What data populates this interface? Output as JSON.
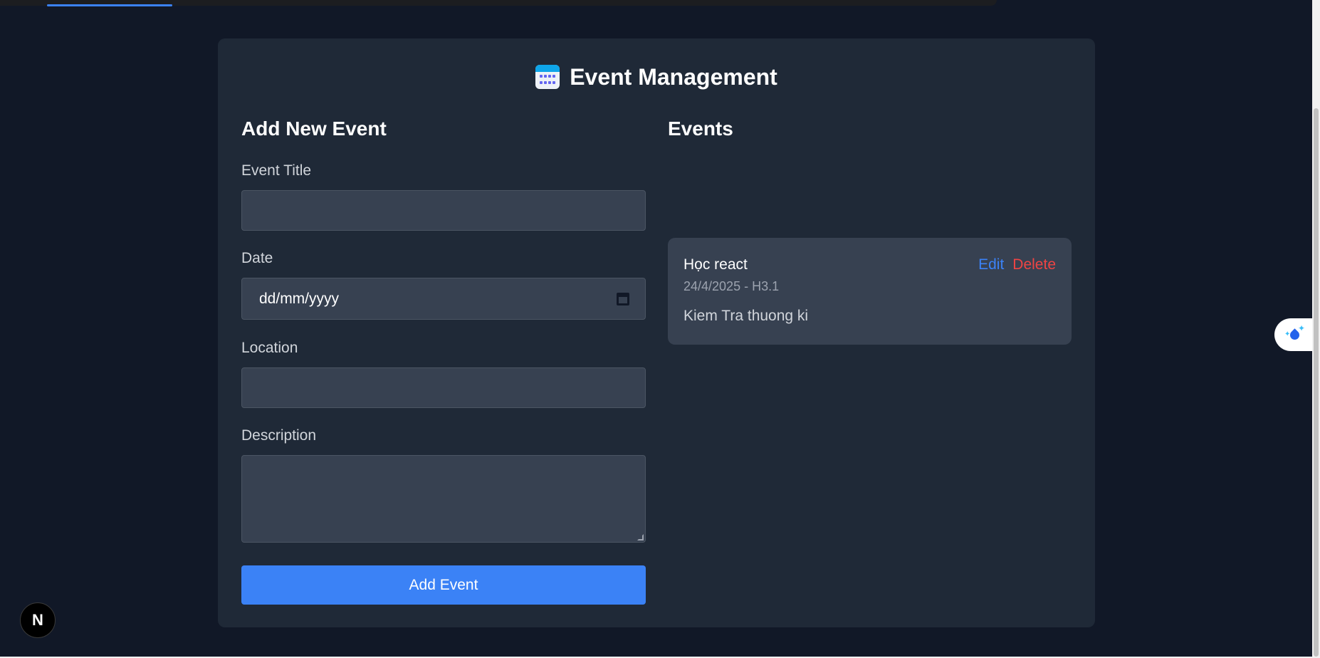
{
  "app": {
    "title": "Event Management",
    "title_icon": "calendar-icon"
  },
  "form": {
    "heading": "Add New Event",
    "fields": {
      "title": {
        "label": "Event Title",
        "value": ""
      },
      "date": {
        "label": "Date",
        "placeholder": "dd/mm/yyyy",
        "value": ""
      },
      "location": {
        "label": "Location",
        "value": ""
      },
      "description": {
        "label": "Description",
        "value": ""
      }
    },
    "submit_label": "Add Event"
  },
  "events": {
    "heading": "Events",
    "items": [
      {
        "title": "Học react",
        "meta": "24/4/2025 - H3.1",
        "description": "Kiem Tra thuong ki",
        "edit_label": "Edit",
        "delete_label": "Delete"
      }
    ]
  },
  "overlay": {
    "nextjs_badge": "N",
    "floating_widget_icon": "sparkle-drop-icon"
  },
  "colors": {
    "page_bg": "#111827",
    "card_bg": "#1f2937",
    "input_bg": "#374151",
    "primary": "#3b82f6",
    "danger": "#ef4444"
  }
}
